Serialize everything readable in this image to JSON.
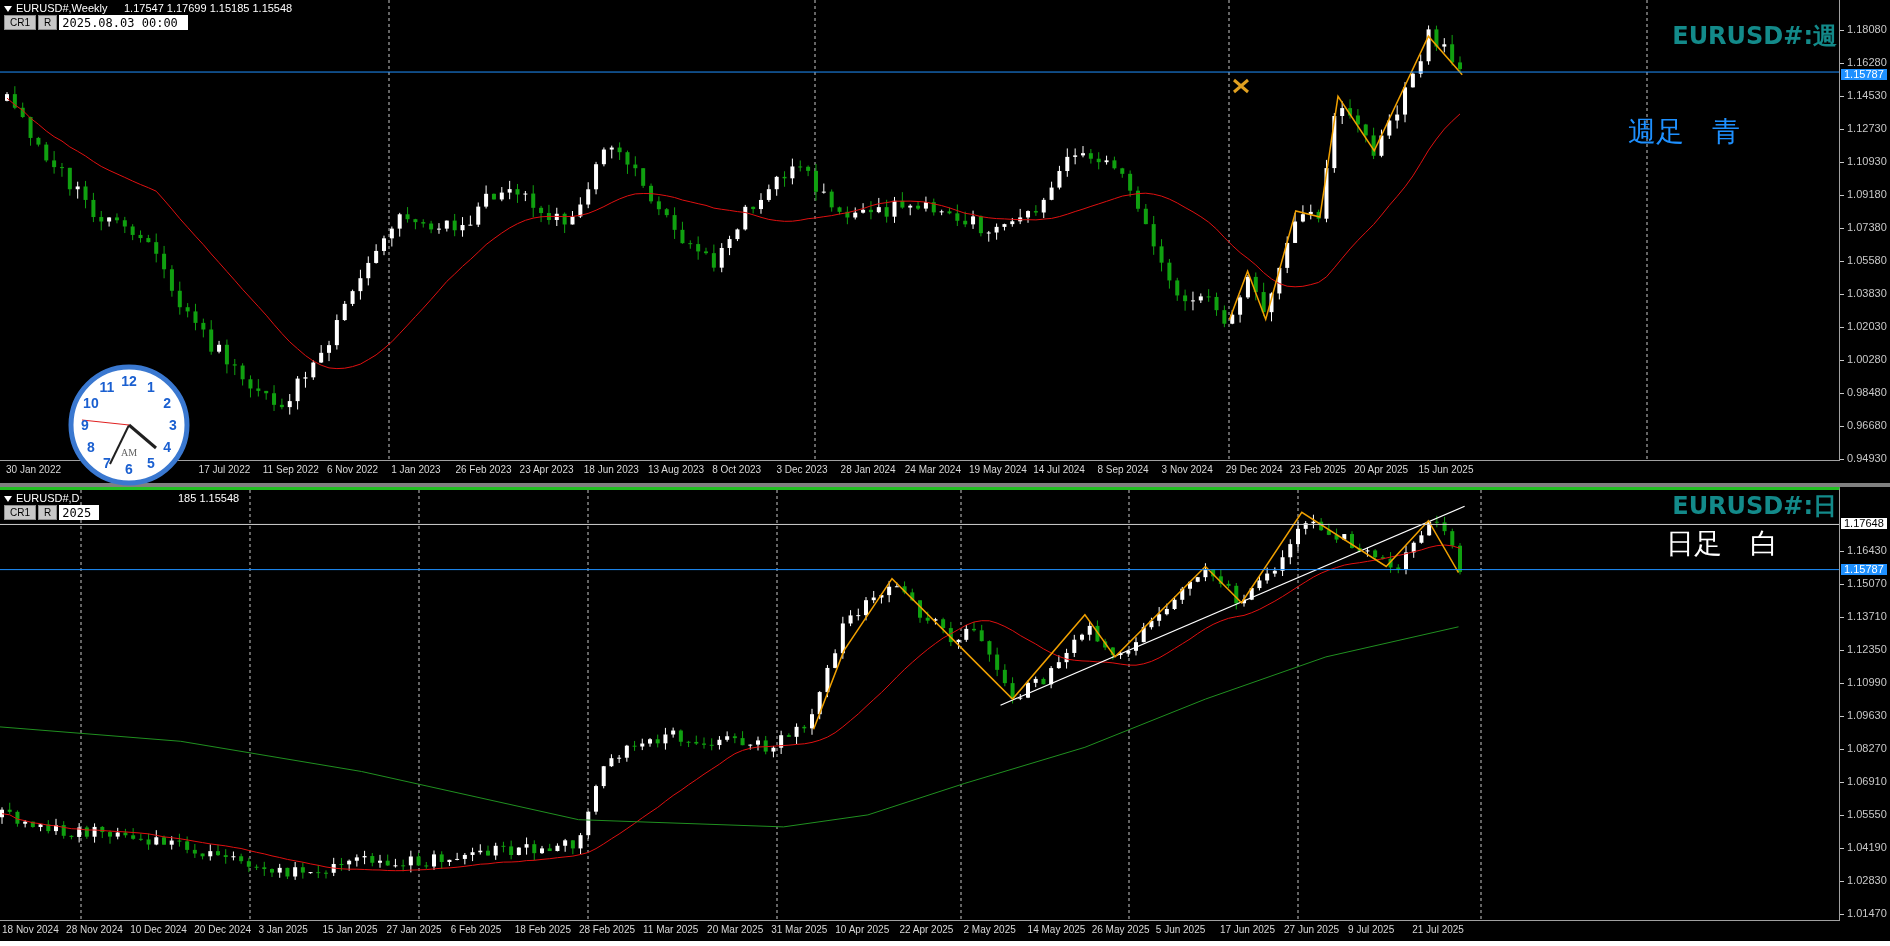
{
  "top_chart": {
    "header": {
      "symbol": "EURUSD#,Weekly",
      "ohlc": "1.17547 1.17699 1.15185 1.15548"
    },
    "buttons": [
      "CR1",
      "R"
    ],
    "date_field": {
      "value": "2025.08.03 00:00"
    },
    "title": "EURUSD#:週",
    "note": "週足　青",
    "price_ticks": [
      "1.18080",
      "1.16280",
      "1.14530",
      "1.12730",
      "1.10930",
      "1.09180",
      "1.07380",
      "1.05580",
      "1.03830",
      "1.02030",
      "1.00280",
      "0.98480",
      "0.96680",
      "0.94930"
    ],
    "price_tags": [
      {
        "kind": "bid",
        "text": "1.15787"
      }
    ],
    "date_labels": [
      "30 Jan 2022",
      "17 Jul 2022",
      "11 Sep 2022",
      "6 Nov 2022",
      "1 Jan 2023",
      "26 Feb 2023",
      "23 Apr 2023",
      "18 Jun 2023",
      "13 Aug 2023",
      "8 Oct 2023",
      "3 Dec 2023",
      "28 Jan 2024",
      "24 Mar 2024",
      "19 May 2024",
      "14 Jul 2024",
      "8 Sep 2024",
      "3 Nov 2024",
      "29 Dec 2024",
      "23 Feb 2025",
      "20 Apr 2025",
      "15 Jun 2025"
    ]
  },
  "bottom_chart": {
    "header": {
      "symbol": "EURUSD#,D",
      "ohlc": "185 1.15548"
    },
    "buttons": [
      "CR1",
      "R"
    ],
    "date_field": {
      "value": "2025"
    },
    "title": "EURUSD#:日",
    "note": "日足　白",
    "price_ticks": [
      "1.16430",
      "1.15070",
      "1.13710",
      "1.12350",
      "1.10990",
      "1.09630",
      "1.08270",
      "1.06910",
      "1.05550",
      "1.04190",
      "1.02830",
      "1.01470"
    ],
    "price_tags": [
      {
        "kind": "level",
        "text": "1.17648"
      },
      {
        "kind": "bid",
        "text": "1.15787"
      }
    ],
    "date_labels": [
      "18 Nov 2024",
      "28 Nov 2024",
      "10 Dec 2024",
      "20 Dec 2024",
      "3 Jan 2025",
      "15 Jan 2025",
      "27 Jan 2025",
      "6 Feb 2025",
      "18 Feb 2025",
      "28 Feb 2025",
      "11 Mar 2025",
      "20 Mar 2025",
      "31 Mar 2025",
      "10 Apr 2025",
      "22 Apr 2025",
      "2 May 2025",
      "14 May 2025",
      "26 May 2025",
      "5 Jun 2025",
      "17 Jun 2025",
      "27 Jun 2025",
      "9 Jul 2025",
      "21 Jul 2025"
    ]
  },
  "clock": {
    "numerals": [
      "12",
      "11",
      "1",
      "10",
      "2",
      "9",
      "3",
      "8",
      "4",
      "7",
      "5",
      "6"
    ],
    "period": "AM"
  }
}
